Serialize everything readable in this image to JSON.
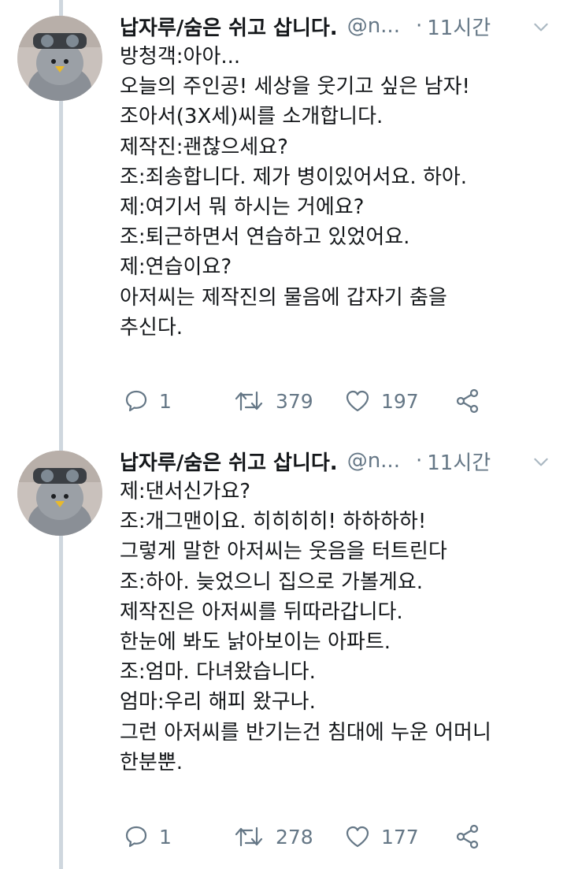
{
  "tweets": [
    {
      "author_name": "납자루/숨은 쉬고 삽니다.",
      "handle": "@n...",
      "separator": "·",
      "time": "11시간",
      "lines": [
        "방청객:아아...",
        "오늘의 주인공! 세상을 웃기고 싶은 남자!",
        "조아서(3X세)씨를 소개합니다.",
        "제작진:괜찮으세요?",
        "조:죄송합니다. 제가 병이있어서요. 하아.",
        "제:여기서 뭐 하시는 거에요?",
        "조:퇴근하면서 연습하고 있었어요.",
        "제:연습이요?",
        "아저씨는 제작진의 물음에 갑자기 춤을",
        "추신다."
      ],
      "replies": "1",
      "retweets": "379",
      "likes": "197"
    },
    {
      "author_name": "납자루/숨은 쉬고 삽니다.",
      "handle": "@n...",
      "separator": "·",
      "time": "11시간",
      "lines": [
        "제:댄서신가요?",
        "조:개그맨이요. 히히히히! 하하하하!",
        "그렇게 말한 아저씨는 웃음을 터트린다",
        "조:하아. 늦었으니 집으로 가볼게요.",
        "제작진은 아저씨를 뒤따라갑니다.",
        "한눈에 봐도 낡아보이는 아파트.",
        "조:엄마. 다녀왔습니다.",
        "엄마:우리 해피 왔구나.",
        "그런 아저씨를 반기는건 침대에 누운 어머니",
        "한분뿐."
      ],
      "replies": "1",
      "retweets": "278",
      "likes": "177"
    }
  ],
  "colors": {
    "text": "#14171a",
    "secondary": "#657786",
    "thread_line": "#cfd7de"
  },
  "icons": {
    "reply": "speech-bubble-icon",
    "retweet": "retweet-arrows-icon",
    "like": "heart-outline-icon",
    "share": "share-nodes-icon",
    "more": "chevron-down-icon"
  }
}
